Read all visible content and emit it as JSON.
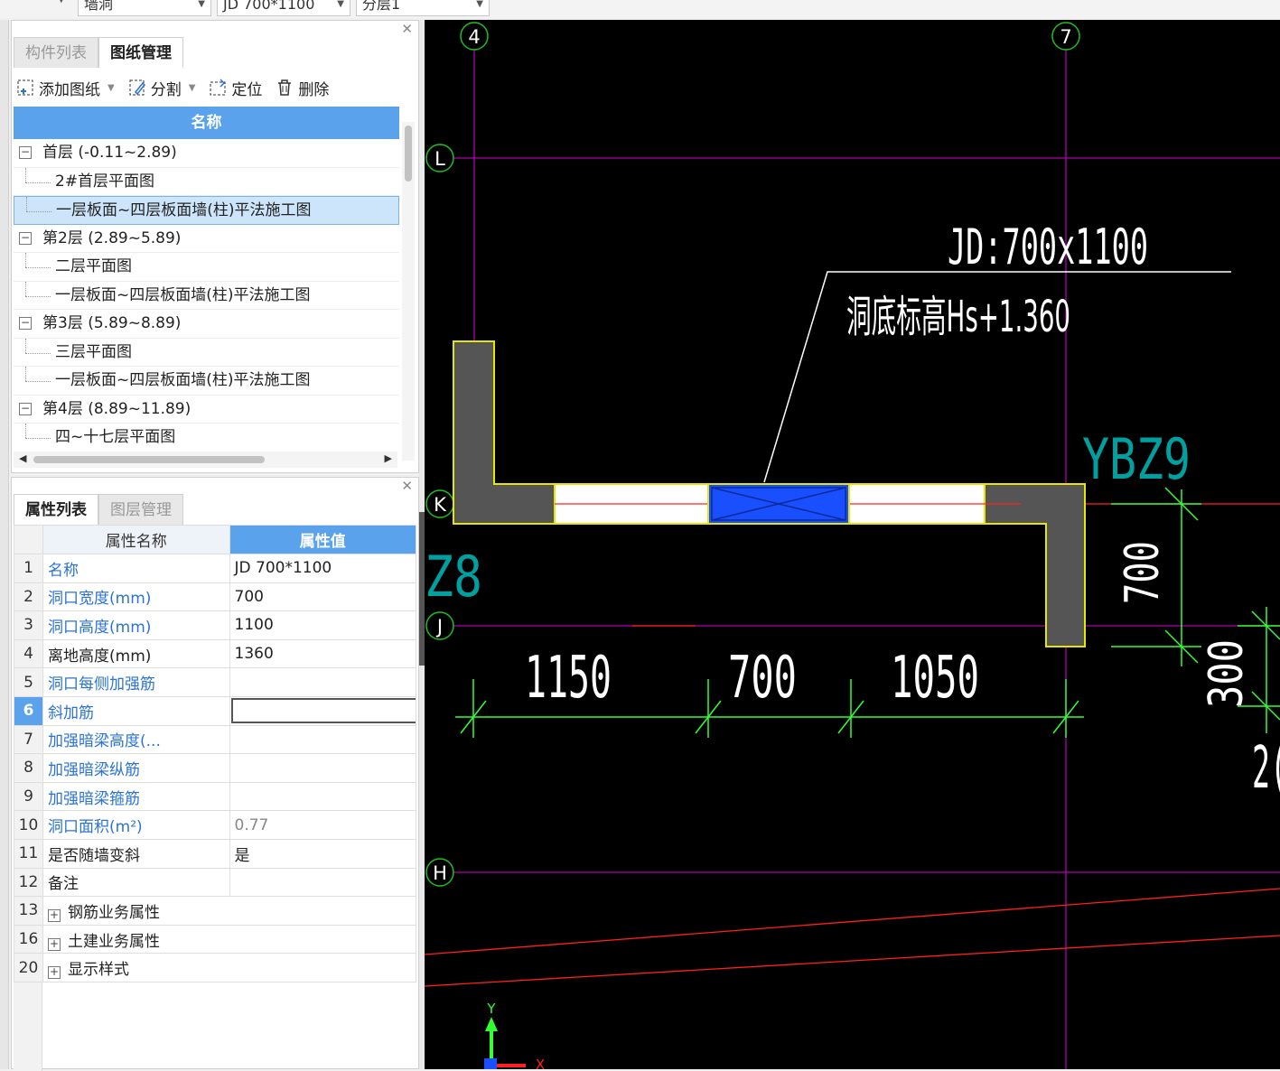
{
  "topbar": {
    "combo1": "墙洞",
    "combo2": "JD 700*1100",
    "combo3": "分层1"
  },
  "drawing_panel": {
    "tabs": [
      "构件列表",
      "图纸管理"
    ],
    "active_tab": "图纸管理",
    "toolbar": {
      "add": "添加图纸",
      "split": "分割",
      "locate": "定位",
      "delete": "删除"
    },
    "column_header": "名称",
    "tree": [
      {
        "type": "group",
        "label": "首层 (-0.11~2.89)"
      },
      {
        "type": "leaf",
        "label": "2#首层平面图"
      },
      {
        "type": "leaf",
        "label": "一层板面~四层板面墙(柱)平法施工图",
        "selected": true
      },
      {
        "type": "group",
        "label": "第2层 (2.89~5.89)"
      },
      {
        "type": "leaf",
        "label": "二层平面图"
      },
      {
        "type": "leaf",
        "label": "一层板面~四层板面墙(柱)平法施工图"
      },
      {
        "type": "group",
        "label": "第3层 (5.89~8.89)"
      },
      {
        "type": "leaf",
        "label": "三层平面图"
      },
      {
        "type": "leaf",
        "label": "一层板面~四层板面墙(柱)平法施工图"
      },
      {
        "type": "group",
        "label": "第4层 (8.89~11.89)"
      },
      {
        "type": "leaf",
        "label": "四~十七层平面图"
      }
    ]
  },
  "property_panel": {
    "tabs": [
      "属性列表",
      "图层管理"
    ],
    "active_tab": "属性列表",
    "headers": {
      "name": "属性名称",
      "value": "属性值"
    },
    "rows": [
      {
        "num": "1",
        "name": "名称",
        "value": "JD 700*1100",
        "blue": true
      },
      {
        "num": "2",
        "name": "洞口宽度(mm)",
        "value": "700",
        "blue": true
      },
      {
        "num": "3",
        "name": "洞口高度(mm)",
        "value": "1100",
        "blue": true
      },
      {
        "num": "4",
        "name": "离地高度(mm)",
        "value": "1360",
        "blue": false
      },
      {
        "num": "5",
        "name": "洞口每侧加强筋",
        "value": "",
        "blue": true
      },
      {
        "num": "6",
        "name": "斜加筋",
        "value": "",
        "blue": true,
        "editing": true
      },
      {
        "num": "7",
        "name": "加强暗梁高度(...",
        "value": "",
        "blue": true
      },
      {
        "num": "8",
        "name": "加强暗梁纵筋",
        "value": "",
        "blue": true
      },
      {
        "num": "9",
        "name": "加强暗梁箍筋",
        "value": "",
        "blue": true
      },
      {
        "num": "10",
        "name": "洞口面积(m²)",
        "value": "0.77",
        "blue": true,
        "gray": true
      },
      {
        "num": "11",
        "name": "是否随墙变斜",
        "value": "是",
        "blue": false
      },
      {
        "num": "12",
        "name": "备注",
        "value": "",
        "blue": false
      },
      {
        "num": "13",
        "name": "钢筋业务属性",
        "value": "",
        "group": true
      },
      {
        "num": "16",
        "name": "土建业务属性",
        "value": "",
        "group": true
      },
      {
        "num": "20",
        "name": "显示样式",
        "value": "",
        "group": true
      }
    ]
  },
  "cad": {
    "axes": {
      "v1": "4",
      "v2": "7",
      "h1": "L",
      "h2": "K",
      "h3": "J",
      "h4": "H"
    },
    "opening_label": "JD:700x1100",
    "elevation_label": "洞底标高Hs+1.360",
    "column_right": "YBZ9",
    "column_left": "Z8",
    "dims": {
      "d1": "1150",
      "d2": "700",
      "d3": "1050",
      "dv1": "700",
      "dv2": "300",
      "partial": "2("
    },
    "ucs": {
      "y": "Y",
      "x": "X"
    },
    "colors": {
      "background": "#000000",
      "axis": "#b000b0",
      "wall": "#555555",
      "outline": "#e6e600",
      "opening": "#1a4fff",
      "dim": "#33ff33",
      "label_cyan": "#00a0a0",
      "red": "#ff2020"
    }
  }
}
